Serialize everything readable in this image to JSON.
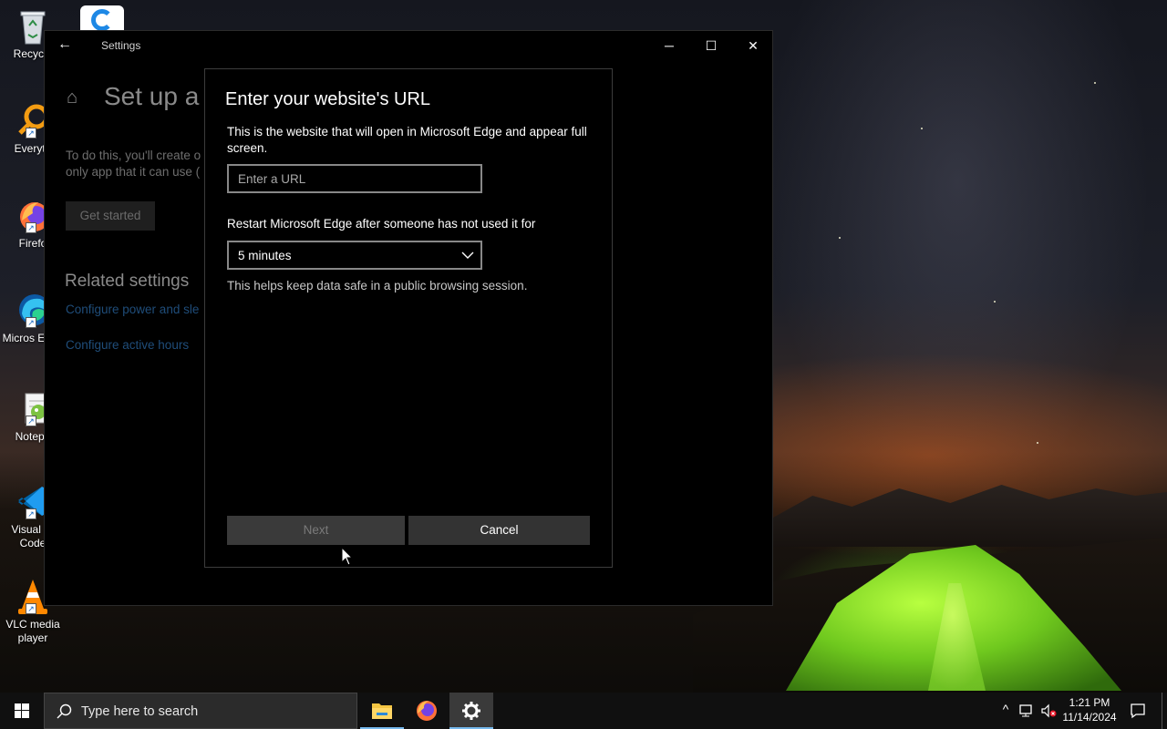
{
  "desktop": {
    "icons": [
      {
        "label": "Recycle"
      },
      {
        "label": "Everyth"
      },
      {
        "label": "Firefo"
      },
      {
        "label": "Micros Edge"
      },
      {
        "label": "Notepa"
      },
      {
        "label": "Visual St Code"
      },
      {
        "label": "VLC media player"
      }
    ]
  },
  "settings": {
    "window_title": "Settings",
    "page_title": "Set up a k",
    "description_line1": "To do this, you'll create o",
    "description_line2": "only app that it can use (",
    "get_started_label": "Get started",
    "related_title": "Related settings",
    "related_links": [
      "Configure power and sle",
      "Configure active hours"
    ]
  },
  "dialog": {
    "title": "Enter your website's URL",
    "description": "This is the website that will open in Microsoft Edge and appear full screen.",
    "url_placeholder": "Enter a URL",
    "url_value": "",
    "restart_label": "Restart Microsoft Edge after someone has not used it for",
    "restart_selected": "5 minutes",
    "help_text": "This helps keep data safe in a public browsing session.",
    "next_label": "Next",
    "cancel_label": "Cancel"
  },
  "taskbar": {
    "search_placeholder": "Type here to search",
    "apps": [
      "file-explorer-icon",
      "firefox-icon",
      "settings-gear-icon"
    ],
    "active_app": "settings-gear-icon",
    "time": "1:21 PM",
    "date": "11/14/2024"
  },
  "colors": {
    "accent": "#76b9ed",
    "dialog_bg": "#000000",
    "button_disabled_bg": "#3a3a3a",
    "button_bg": "#333333"
  }
}
